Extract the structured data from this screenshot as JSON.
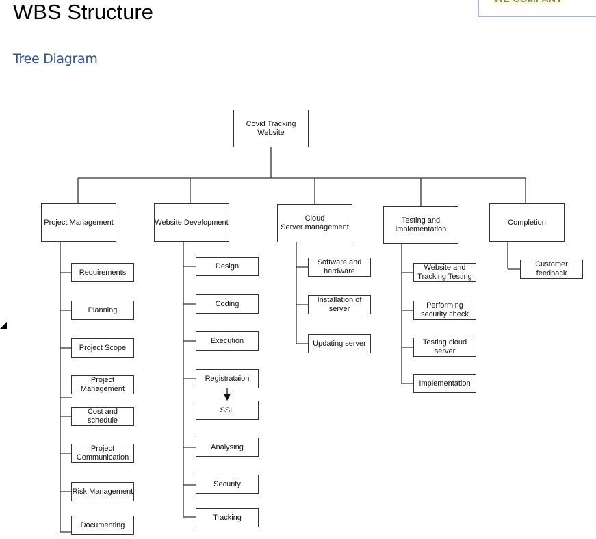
{
  "header": {
    "title": "WBS Structure",
    "subtitle": "Tree Diagram",
    "logo_text": "WE COMPANY"
  },
  "colors": {
    "subtitle": "#2f5597",
    "logo_border": "#a5b8db",
    "logo_highlight": "#ffffcc",
    "logo_text": "#7f7f7f",
    "line": "#333333"
  },
  "diagram": {
    "root": "Covid Tracking\nWebsite",
    "branches": [
      {
        "label": "Project Management",
        "children": [
          "Requirements",
          "Planning",
          "Project Scope",
          "Project\nManagement",
          "Cost and\nschedule",
          "Project\nCommunication",
          "Risk Management",
          "Documenting"
        ]
      },
      {
        "label": "Website Development",
        "children": [
          "Design",
          "Coding",
          "Execution",
          "Registrataion",
          "SSL",
          "Analysing",
          "Security",
          "Tracking"
        ],
        "arrow": {
          "from": "Registrataion",
          "to": "SSL"
        }
      },
      {
        "label": "Cloud\nServer management",
        "children": [
          "Software and\nhardware",
          "Installation of\nserver",
          "Updating server"
        ]
      },
      {
        "label": "Testing and\nimplementation",
        "children": [
          "Website and\nTracking Testing",
          "Performing\nsecurity check",
          "Testing cloud\nserver",
          "Implementation"
        ]
      },
      {
        "label": "Completion",
        "children": [
          "Customer\nfeedback"
        ]
      }
    ]
  }
}
